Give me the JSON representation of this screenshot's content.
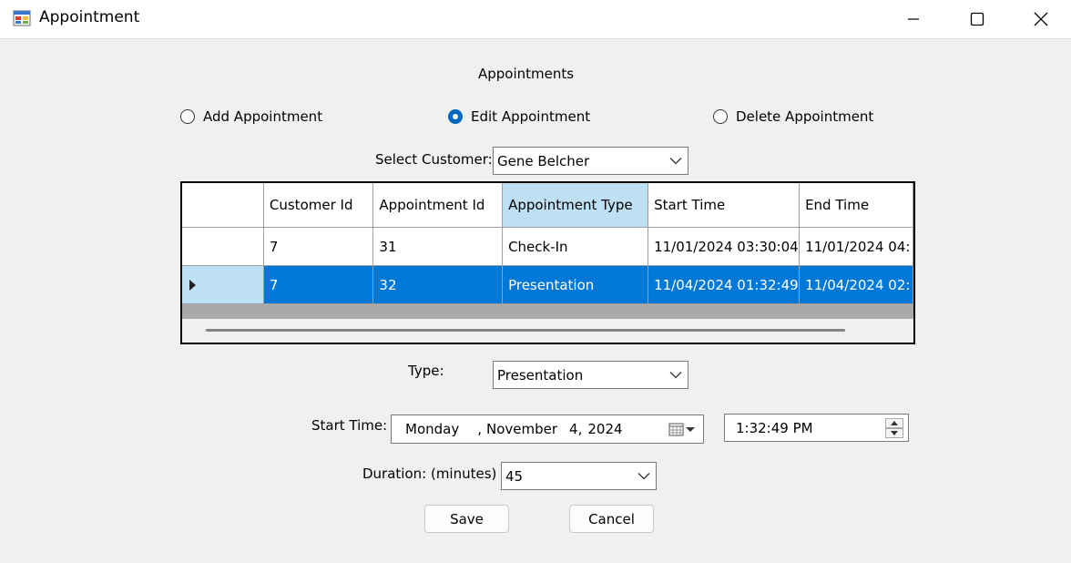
{
  "window": {
    "title": "Appointment",
    "icon": "app-window-icon"
  },
  "heading": "Appointments",
  "mode_options": [
    {
      "label": "Add Appointment",
      "checked": false
    },
    {
      "label": "Edit Appointment",
      "checked": true
    },
    {
      "label": "Delete Appointment",
      "checked": false
    }
  ],
  "customer": {
    "label": "Select Customer:",
    "value": "Gene Belcher"
  },
  "grid": {
    "columns": [
      "Customer Id",
      "Appointment Id",
      "Appointment Type",
      "Start Time",
      "End Time"
    ],
    "rows": [
      [
        "7",
        "31",
        "Check-In",
        "11/01/2024 03:30:04",
        "11/01/2024 04:"
      ],
      [
        "7",
        "32",
        "Presentation",
        "11/04/2024 01:32:49",
        "11/04/2024 02:"
      ]
    ],
    "selected_row": 1
  },
  "type": {
    "label": "Type:",
    "value": "Presentation"
  },
  "start_time": {
    "label": "Start Time:",
    "date": {
      "weekday": "Monday",
      "sep1": ",",
      "month": "November",
      "day": "4,",
      "year": "2024"
    },
    "time": "1:32:49 PM"
  },
  "duration": {
    "label": "Duration: (minutes)",
    "value": "45"
  },
  "buttons": {
    "save": "Save",
    "cancel": "Cancel"
  },
  "colors": {
    "selection": "#0078d7",
    "accent": "#0067c0",
    "header_highlight": "#bee0f5"
  }
}
